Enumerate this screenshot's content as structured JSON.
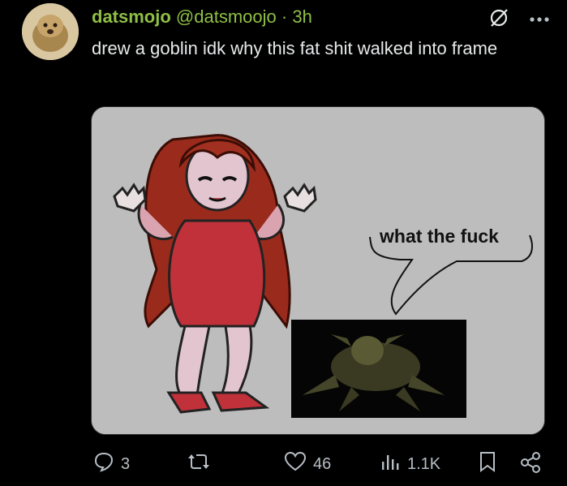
{
  "post": {
    "display_name": "datsmojo",
    "handle": "@datsmoojo",
    "separator": "·",
    "time": "3h",
    "text": "drew a goblin  idk why this fat shit walked into frame",
    "media": {
      "speech_bubble_text": "what the fuck"
    }
  },
  "actions": {
    "replies": "3",
    "reposts": "",
    "likes": "46",
    "views": "1.1K"
  },
  "colors": {
    "name_accent": "#8fbf45",
    "background": "#000000",
    "text": "#e7e9ea",
    "muted": "#b7bec4"
  },
  "icons": [
    "verified-icon",
    "more-icon",
    "reply-icon",
    "repost-icon",
    "like-icon",
    "views-icon",
    "bookmark-icon",
    "share-icon"
  ]
}
